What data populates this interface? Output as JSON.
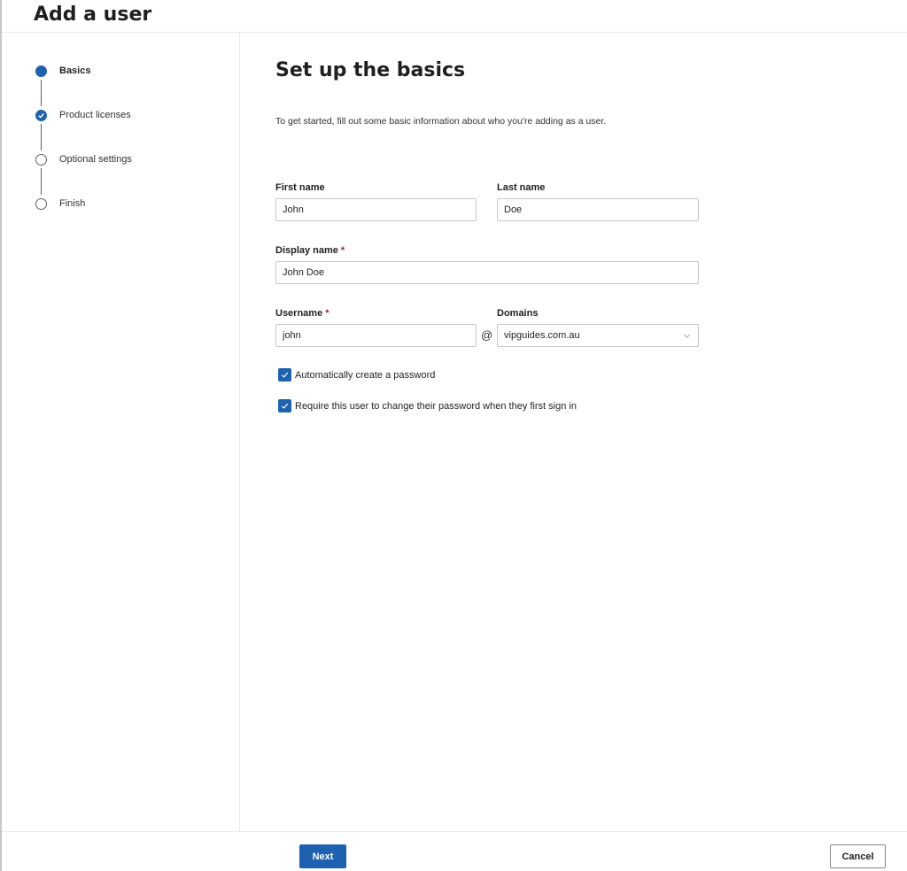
{
  "page": {
    "title": "Add a user"
  },
  "steps": [
    {
      "label": "Basics",
      "state": "current"
    },
    {
      "label": "Product licenses",
      "state": "complete"
    },
    {
      "label": "Optional settings",
      "state": "pending"
    },
    {
      "label": "Finish",
      "state": "pending"
    }
  ],
  "main": {
    "title": "Set up the basics",
    "intro": "To get started, fill out some basic information about who you're adding as a user."
  },
  "form": {
    "first_name": {
      "label": "First name",
      "value": "John"
    },
    "last_name": {
      "label": "Last name",
      "value": "Doe"
    },
    "display_name": {
      "label": "Display name",
      "required_marker": "*",
      "value": "John Doe"
    },
    "username": {
      "label": "Username",
      "required_marker": "*",
      "value": "john"
    },
    "at_symbol": "@",
    "domains": {
      "label": "Domains",
      "value": "vipguides.com.au"
    },
    "auto_password": {
      "label": "Automatically create a password",
      "checked": true
    },
    "require_change": {
      "label": "Require this user to change their password when they first sign in",
      "checked": true
    }
  },
  "footer": {
    "next_label": "Next",
    "cancel_label": "Cancel"
  },
  "colors": {
    "accent": "#1e61b0",
    "required": "#a4262c",
    "border": "#c8c6c4"
  },
  "icons": {
    "complete_step": "checkmark-icon",
    "checkbox": "checkmark-icon",
    "dropdown": "chevron-down-icon"
  }
}
